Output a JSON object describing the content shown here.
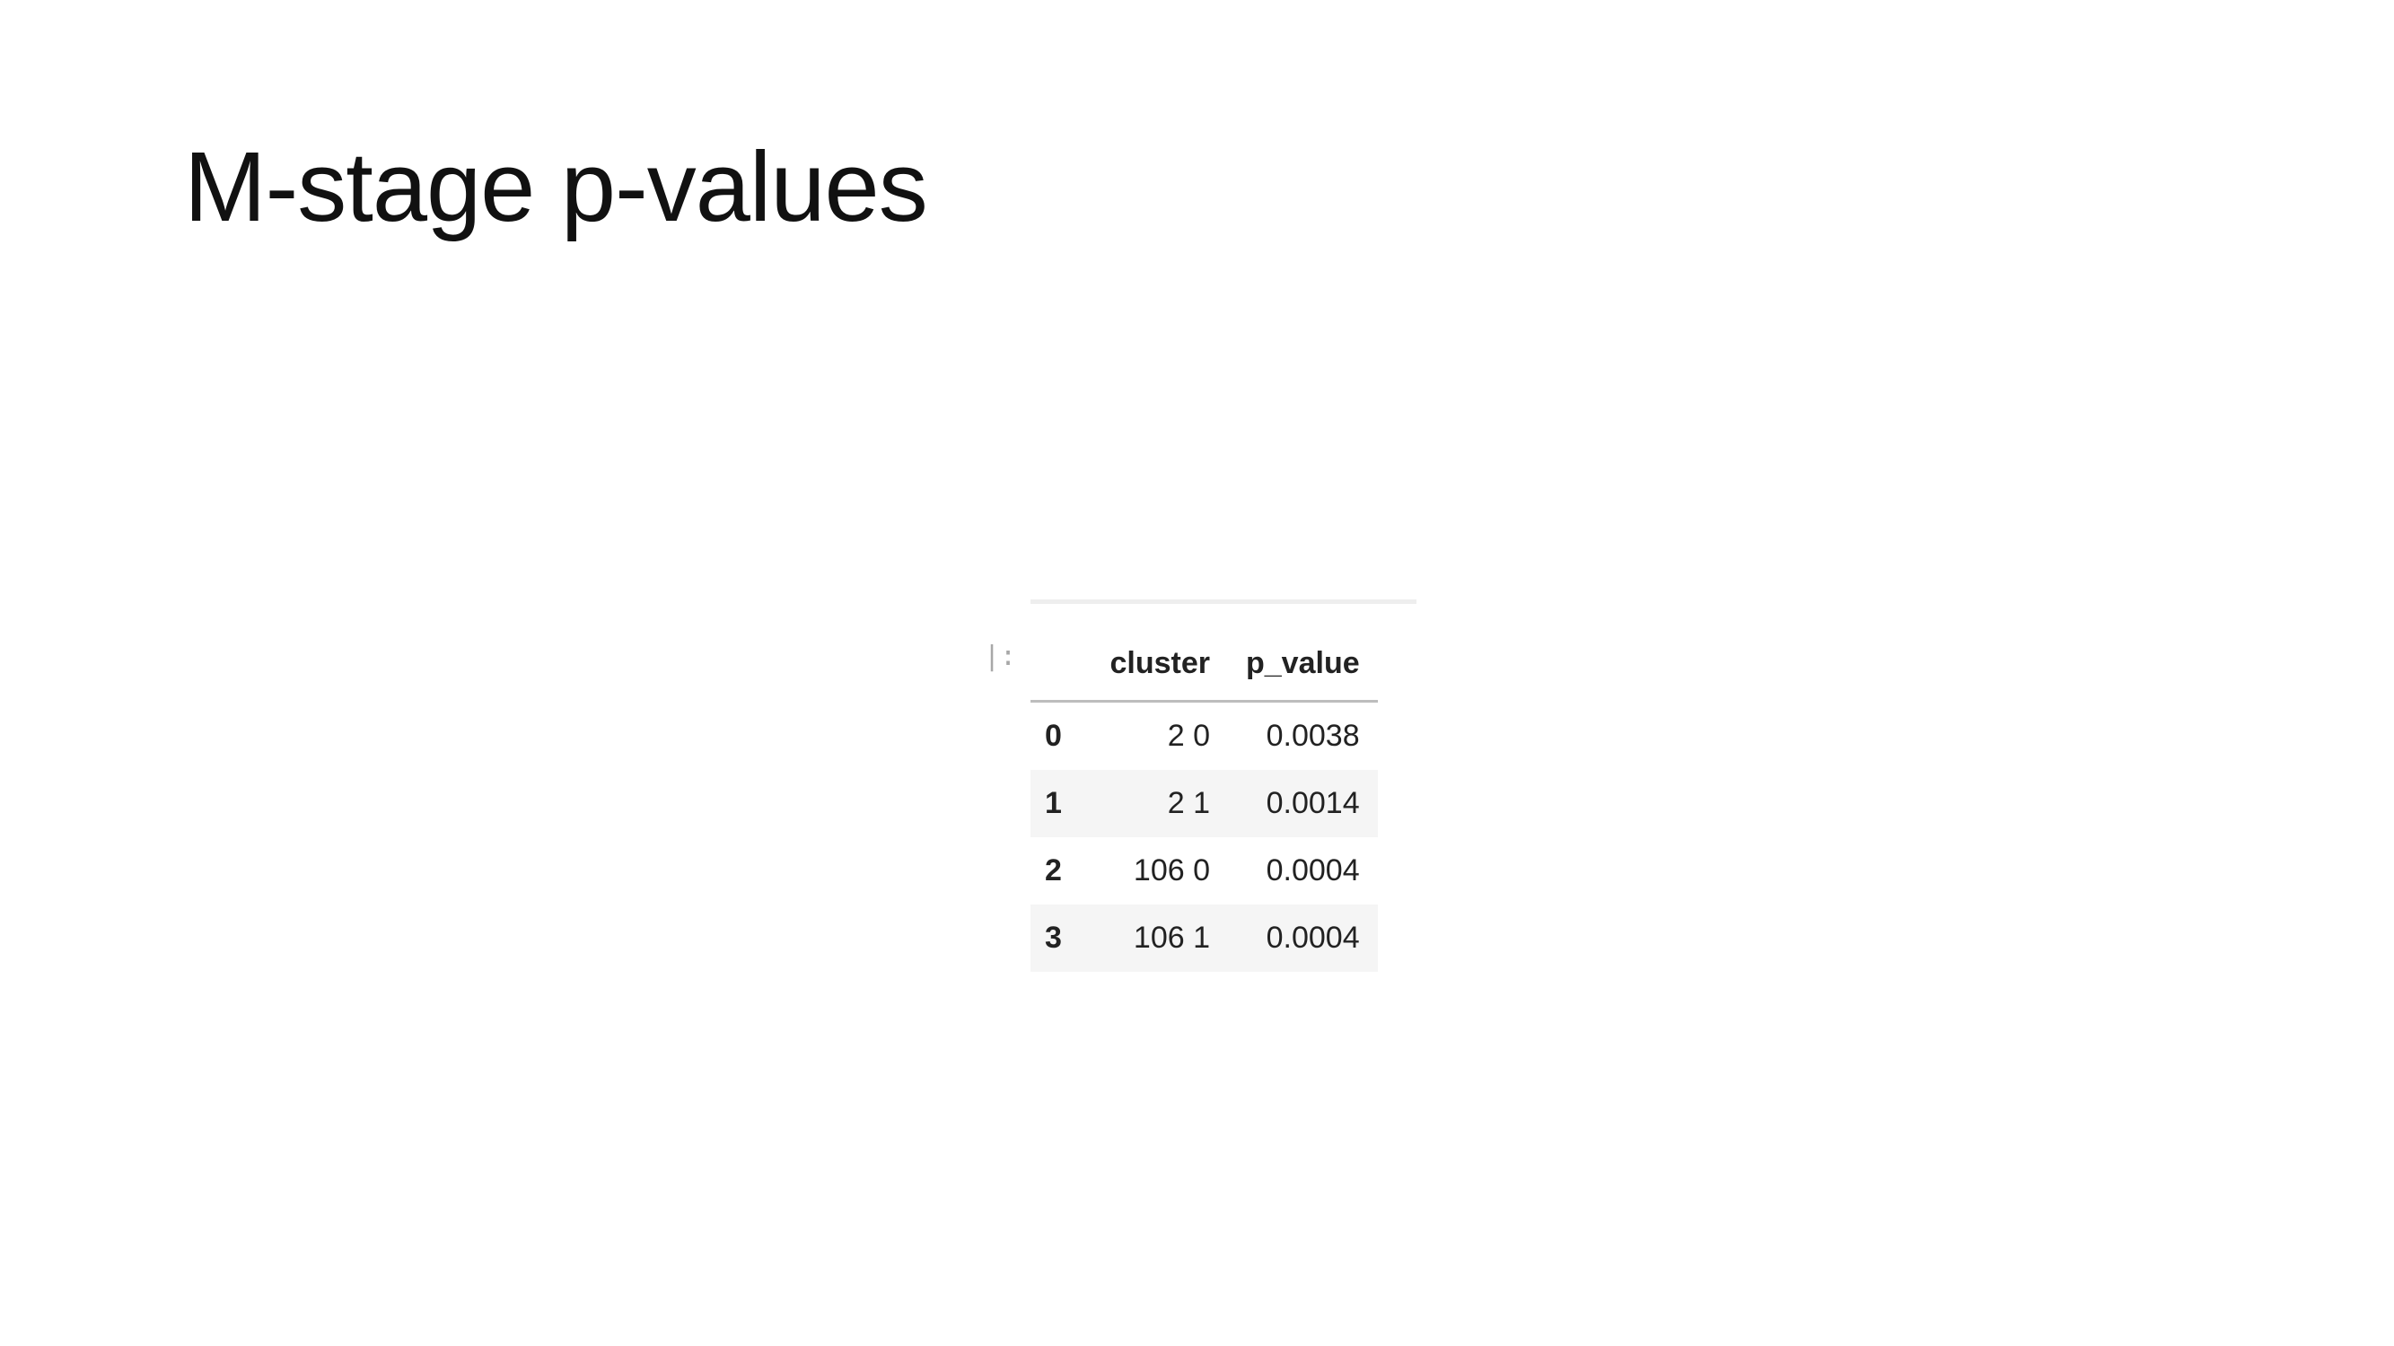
{
  "slide": {
    "title": "M-stage p-values"
  },
  "notebook": {
    "prompt": "|:"
  },
  "table": {
    "columns": [
      "",
      "cluster",
      "p_value"
    ],
    "rows": [
      {
        "index": "0",
        "cluster": "2 0",
        "p_value": "0.0038"
      },
      {
        "index": "1",
        "cluster": "2 1",
        "p_value": "0.0014"
      },
      {
        "index": "2",
        "cluster": "106 0",
        "p_value": "0.0004"
      },
      {
        "index": "3",
        "cluster": "106 1",
        "p_value": "0.0004"
      }
    ]
  }
}
